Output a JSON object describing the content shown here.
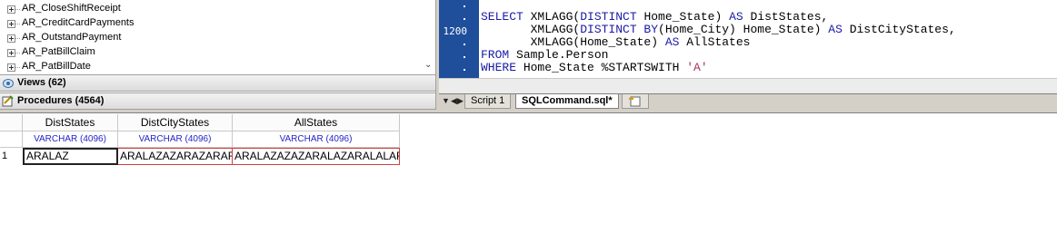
{
  "tree": {
    "items": [
      {
        "label": "AR_CloseShiftReceipt"
      },
      {
        "label": "AR_CreditCardPayments"
      },
      {
        "label": "AR_OutstandPayment"
      },
      {
        "label": "AR_PatBillClaim"
      },
      {
        "label": "AR_PatBillDate"
      }
    ]
  },
  "sections": {
    "views": "Views (62)",
    "procedures": "Procedures (4564)"
  },
  "editor": {
    "gutter_line_number": "1200",
    "code": {
      "l1_kw1": "SELECT",
      "l1_mid": " XMLAGG(",
      "l1_kw2": "DISTINCT",
      "l1_rest1": " Home_State) ",
      "l1_kw3": "AS",
      "l1_rest2": " DistStates,",
      "l2_pre": "       XMLAGG(",
      "l2_kw1": "DISTINCT BY",
      "l2_rest1": "(Home_City) Home_State) ",
      "l2_kw2": "AS",
      "l2_rest2": " DistCityStates,",
      "l3_pre": "       XMLAGG(Home_State) ",
      "l3_kw": "AS",
      "l3_rest": " AllStates",
      "l4_kw": "FROM",
      "l4_rest": " Sample.Person",
      "l5_kw": "WHERE",
      "l5_mid": " Home_State %STARTSWITH ",
      "l5_str": "'A'"
    }
  },
  "tabs": [
    {
      "label": "Script 1"
    },
    {
      "label": "SQLCommand.sql*"
    }
  ],
  "results": {
    "columns": [
      {
        "name": "DistStates",
        "type": "VARCHAR (4096)"
      },
      {
        "name": "DistCityStates",
        "type": "VARCHAR (4096)"
      },
      {
        "name": "AllStates",
        "type": "VARCHAR (4096)"
      }
    ],
    "rows": [
      {
        "num": "1",
        "values": [
          "ARALAZ",
          "ARALAZAZARAZARAR",
          "ARALAZAZAZARALAZARALALAR"
        ]
      }
    ]
  },
  "colors": {
    "gutter": "#1f4e9b",
    "keyword": "#1a1aa6",
    "string": "#b03060",
    "type_text": "#2424c8",
    "cell_border": "#d04040"
  }
}
